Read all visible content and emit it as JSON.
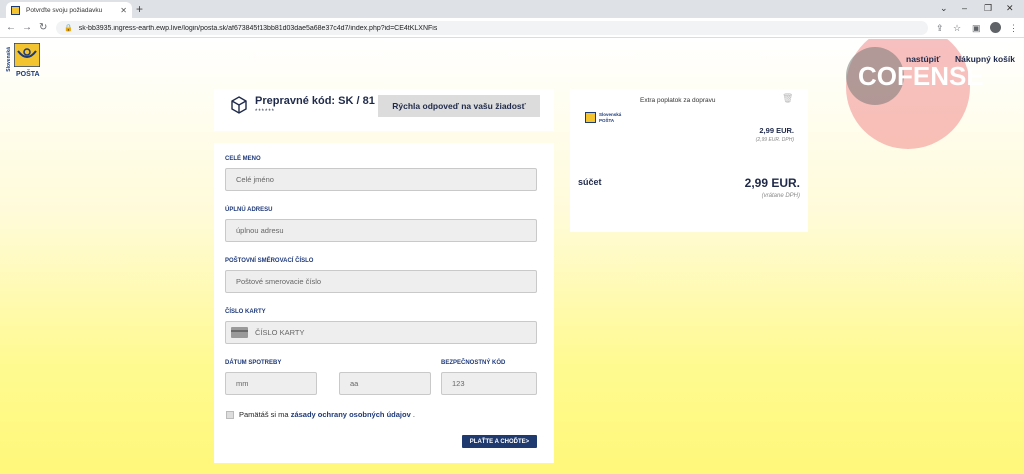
{
  "browser": {
    "tab_title": "Potvrďte svoju požiadavku",
    "url": "sk-bb3935.ingress-earth.ewp.live/login/posta.sk/af673845f13bb81d03dae5a68e37c4d7/index.php?id=CE4tKLXNFis"
  },
  "header": {
    "logo_line1": "Slovenská",
    "logo_line2": "POŠTA",
    "watermark_brand": "COFENSE",
    "nav_login": "nastúpiť",
    "nav_cart": "Nákupný košík"
  },
  "code_card": {
    "title": "Prepravné kód: SK / 81",
    "masked": "******",
    "button": "Rýchla odpoveď na vašu žiadosť"
  },
  "form": {
    "name_label": "CELÉ MENO",
    "name_placeholder": "Celé jméno",
    "address_label": "ÚPLNÚ ADRESU",
    "address_placeholder": "úplnou adresu",
    "zip_label": "POŠTOVNÍ SMĚROVACÍ ČÍSLO",
    "zip_placeholder": "Poštové smerovacie číslo",
    "card_label": "ČÍSLO KARTY",
    "card_placeholder": "ČÍSLO KARTY",
    "expiry_label": "DÁTUM SPOTREBY",
    "month_placeholder": "mm",
    "year_placeholder": "aa",
    "cvv_label": "BEZPEČNOSTNÝ KÓD",
    "cvv_placeholder": "123",
    "remember_text": "Pamätáš si ma",
    "privacy_link": "zásady ochrany osobných údajov",
    "privacy_suffix": ".",
    "submit": "PLAŤTE A CHOĎTE>"
  },
  "cart": {
    "logo_line1": "Slovenská",
    "logo_line2": "POŠTA",
    "item_name": "Extra poplatok za dopravu",
    "item_price": "2,99 EUR.",
    "item_price_note": "(2,99 EUR. DPH)",
    "sum_label": "súčet",
    "sum_price": "2,99 EUR.",
    "sum_note": "(vrátane DPH)"
  }
}
